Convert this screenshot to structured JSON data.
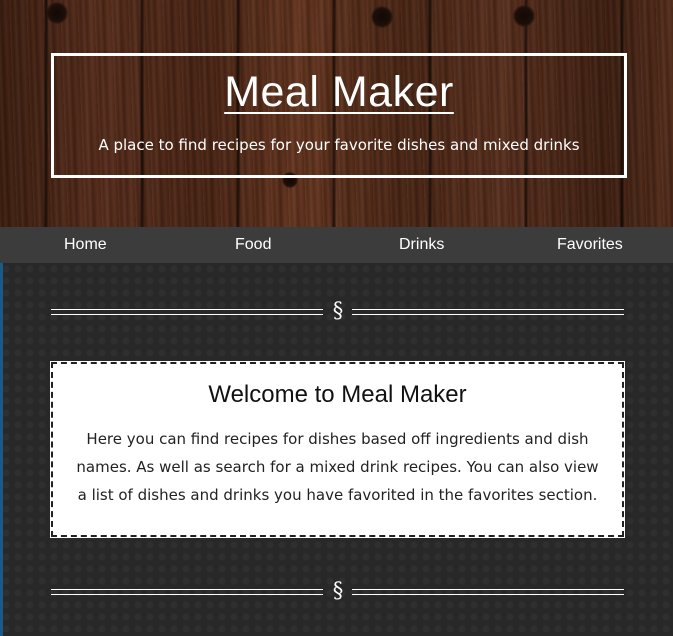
{
  "header": {
    "title": "Meal Maker",
    "subtitle": "A place to find recipes for your favorite dishes and mixed drinks"
  },
  "nav": {
    "items": [
      {
        "label": "Home"
      },
      {
        "label": "Food"
      },
      {
        "label": "Drinks"
      },
      {
        "label": "Favorites"
      }
    ]
  },
  "divider": {
    "symbol": "§"
  },
  "welcome": {
    "title": "Welcome to Meal Maker",
    "text": "Here you can find recipes for dishes based off ingredients and dish names. As well as search for a mixed drink recipes. You can also view a list of dishes and drinks you have favorited in the favorites section."
  },
  "colors": {
    "nav_background": "#3c3c3c",
    "page_background": "#282828",
    "card_background": "#ffffff",
    "text_light": "#ffffff"
  }
}
